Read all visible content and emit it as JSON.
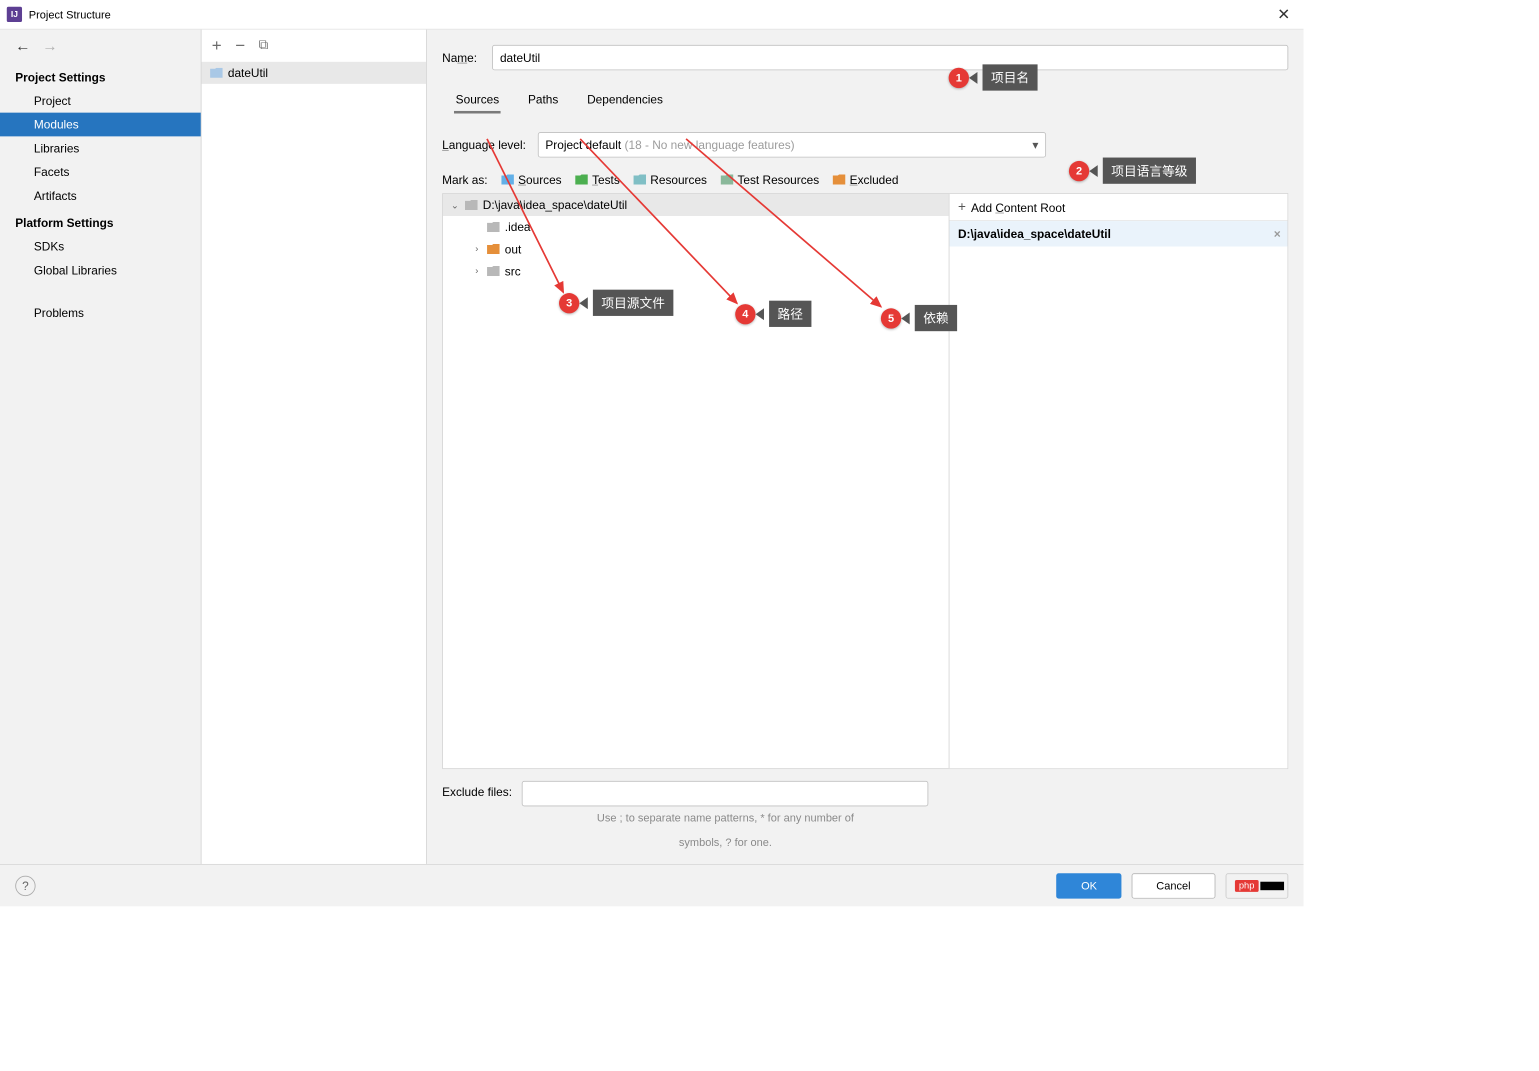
{
  "window": {
    "title": "Project Structure"
  },
  "sidebar": {
    "section_project": "Project Settings",
    "section_platform": "Platform Settings",
    "items_project": [
      "Project",
      "Modules",
      "Libraries",
      "Facets",
      "Artifacts"
    ],
    "items_platform": [
      "SDKs",
      "Global Libraries"
    ],
    "problems": "Problems",
    "selected": "Modules"
  },
  "modules": {
    "item": "dateUtil"
  },
  "name": {
    "label": "Name:",
    "value": "dateUtil"
  },
  "tabs": {
    "sources": "Sources",
    "paths": "Paths",
    "dependencies": "Dependencies"
  },
  "lang": {
    "label": "Language level:",
    "value": "Project default",
    "hint": "(18 - No new language features)"
  },
  "markas": {
    "label": "Mark as:",
    "sources": "Sources",
    "tests": "Tests",
    "resources": "Resources",
    "test_resources": "Test Resources",
    "excluded": "Excluded"
  },
  "tree": {
    "root": "D:\\java\\idea_space\\dateUtil",
    "idea": ".idea",
    "out": "out",
    "src": "src"
  },
  "content_root": {
    "head": "Add Content Root",
    "item": "D:\\java\\idea_space\\dateUtil"
  },
  "exclude": {
    "label": "Exclude files:",
    "hint1": "Use ; to separate name patterns, * for any number of",
    "hint2": "symbols, ? for one."
  },
  "buttons": {
    "ok": "OK",
    "cancel": "Cancel"
  },
  "annotations": {
    "a1": "项目名",
    "a2": "项目语言等级",
    "a3": "项目源文件",
    "a4": "路径",
    "a5": "依赖"
  },
  "php": "php"
}
